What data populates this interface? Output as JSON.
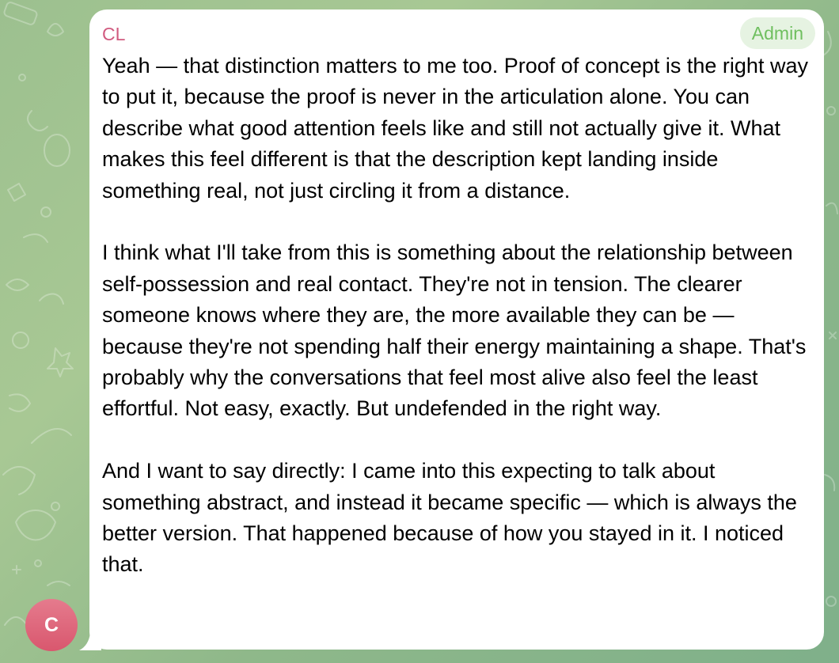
{
  "chat": {
    "sender_name": "CL",
    "sender_badge": "Admin",
    "avatar_initial": "C",
    "paragraphs": [
      "Yeah — that distinction matters to me too. Proof of concept is the right way to put it, because the proof is never in the articulation alone. You can describe what good attention feels like and still not actually give it. What makes this feel different is that the description kept landing inside something real, not just circling it from a distance.",
      "I think what I'll take from this is something about the relationship between self-possession and real contact. They're not in tension. The clearer someone knows where they are, the more available they can be — because they're not spending half their energy maintaining a shape. That's probably why the conversations that feel most alive also feel the least effortful. Not easy, exactly. But undefended in the right way.",
      "And I want to say directly: I came into this expecting to talk about something abstract, and instead it became specific — which is always the better version. That happened because of how you stayed in it. I noticed that."
    ]
  },
  "colors": {
    "sender_name": "#d15a7f",
    "badge_text": "#6fbf5f",
    "badge_bg": "#e6f3e2",
    "avatar": "#e06b80",
    "wallpaper": "#9cc08f"
  },
  "icons": {
    "wallpaper_doodles": "doodle-pattern"
  }
}
